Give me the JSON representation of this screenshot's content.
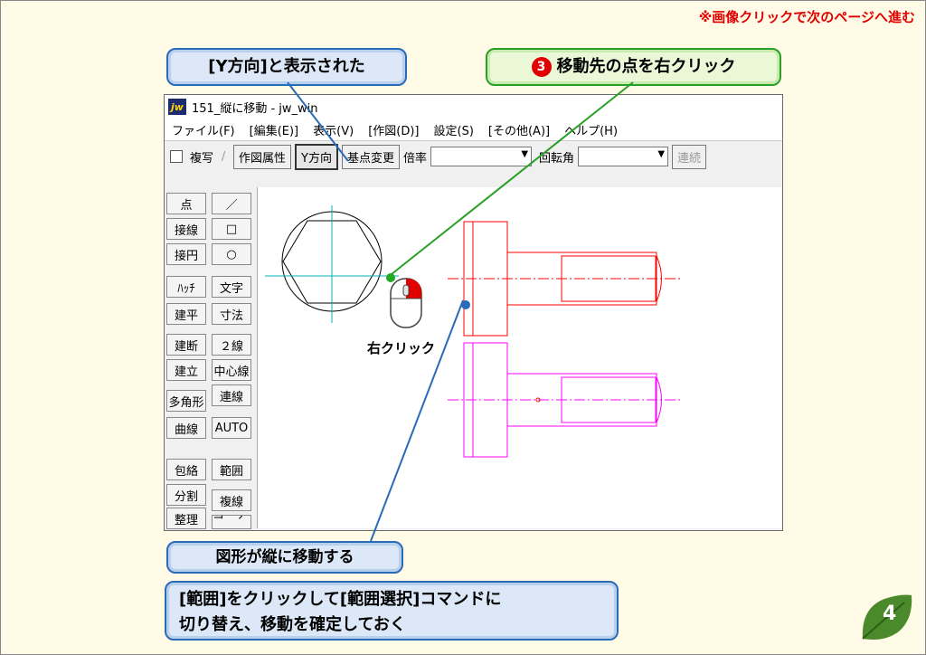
{
  "top_note": "※画像クリックで次のページへ進む",
  "callouts": {
    "y_direction_shown": "[Y方向]と表示された",
    "step_number": "❸",
    "step_text": "移動先の点を右クリック",
    "figure_moves": "図形が縦に移動する",
    "switch_line1": "[範囲]をクリックして[範囲選択]コマンドに",
    "switch_line2": "切り替え、移動を確定しておく"
  },
  "mouse_label": "右クリック",
  "window": {
    "icon_text": "jw",
    "title": "151_縦に移動 - jw_win",
    "menu": [
      "ファイル(F)",
      "[編集(E)]",
      "表示(V)",
      "[作図(D)]",
      "設定(S)",
      "[その他(A)]",
      "ヘルプ(H)"
    ],
    "toolbar": {
      "copy_label": "複写",
      "slash": "/",
      "attr": "作図属性",
      "y_dir": "Y方向",
      "base_change": "基点変更",
      "scale_label": "倍率",
      "rotate_label": "回転角",
      "continuous": "連続"
    },
    "left_tools": [
      [
        "点",
        "／"
      ],
      [
        "接線",
        "□"
      ],
      [
        "接円",
        "○"
      ],
      [
        "ﾊｯﾁ",
        "文字"
      ],
      [
        "建平",
        "寸法"
      ],
      [
        "建断",
        "２線"
      ],
      [
        "建立",
        "中心線"
      ],
      [
        "多角形",
        "連線"
      ],
      [
        "曲線",
        "AUTO"
      ],
      [
        "包絡",
        "範囲"
      ],
      [
        "分割",
        "複線"
      ],
      [
        "整理",
        "コーナー"
      ]
    ]
  },
  "page_number": "4",
  "colors": {
    "callout_blue": "#2a6bb8",
    "callout_green": "#2aa02a",
    "red_drawing": "#ff0000",
    "magenta_drawing": "#ff00ff",
    "cyan_centerline": "#00b4b4"
  }
}
